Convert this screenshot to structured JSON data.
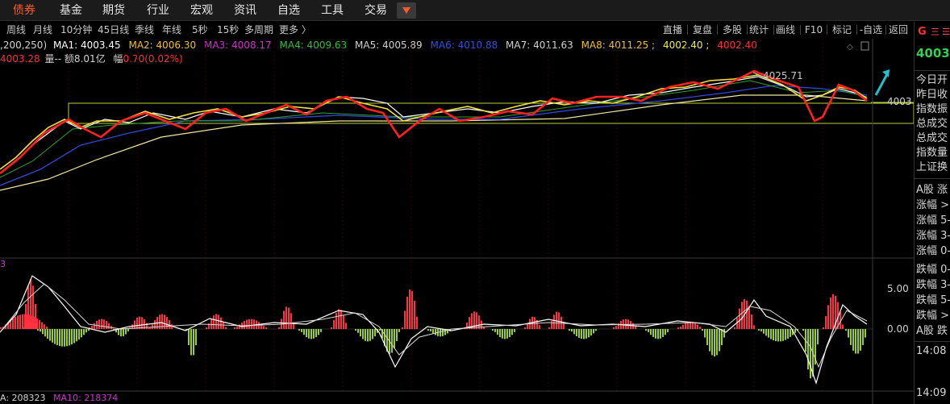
{
  "nav": {
    "items": [
      "债券",
      "基金",
      "期货",
      "行业",
      "宏观",
      "资讯",
      "自选",
      "工具",
      "交易"
    ],
    "active_index": 0
  },
  "periods": [
    "周线",
    "月线",
    "10分钟",
    "45日线",
    "季线",
    "年线",
    "5秒",
    "15秒",
    "多周期",
    "更多 〉"
  ],
  "tools": [
    "直播",
    "复盘",
    "多股",
    "统计",
    "画线",
    "F10",
    "标记",
    "-自选",
    "返回"
  ],
  "ma_row": {
    "params": ",200,250)",
    "items": [
      {
        "label": "MA1: 4003.45",
        "color": "#ffffff"
      },
      {
        "label": "MA2: 4006.30",
        "color": "#f0c020"
      },
      {
        "label": "MA3: 4008.17",
        "color": "#d030d0"
      },
      {
        "label": "MA4: 4009.63",
        "color": "#30c030"
      },
      {
        "label": "MA5: 4005.89",
        "color": "#d0d0d0"
      },
      {
        "label": "MA6: 4010.88",
        "color": "#3050e0"
      },
      {
        "label": "MA7: 4011.63",
        "color": "#d0d0d0"
      },
      {
        "label": "MA8: 4011.25 ;",
        "color": "#f0c020"
      },
      {
        "label": "4002.40 ;",
        "color": "#f0f040"
      },
      {
        "label": "4002.40",
        "color": "#ff3030"
      }
    ]
  },
  "info_row": {
    "price": "4003.28",
    "vol_label": "量-- 额8.01亿",
    "amp_label": "幅",
    "amp_value": "0.70(0.02%)"
  },
  "chart_labels": {
    "peak": "4025.71",
    "level": "4003",
    "macd_top": "5.00",
    "macd_zero": "0.00",
    "bottom_prefix": "3",
    "vol_label": "A: 208323",
    "vol_ma10": "MA10: 218374"
  },
  "right_panel": {
    "price": "4003.",
    "flags": [
      "G",
      "三",
      "☰"
    ],
    "rows": [
      "今日开",
      "昨日收",
      "指数振",
      "总成交",
      "总成交",
      "指数量",
      "上证换",
      "A股 涨",
      "涨幅 >",
      "涨幅 5-",
      "涨幅 3-",
      "涨幅 0-",
      "跌幅 0-",
      "跌幅 3-",
      "跌幅 5-",
      "跌幅 >",
      "A股 跌"
    ],
    "times": [
      "14:08",
      "14:09"
    ]
  },
  "colors": {
    "nav_active": "#ff5a2a",
    "up": "#ff3040",
    "down": "#9ad020",
    "price_green": "#30d050",
    "arrow": "#20c0d0"
  }
}
